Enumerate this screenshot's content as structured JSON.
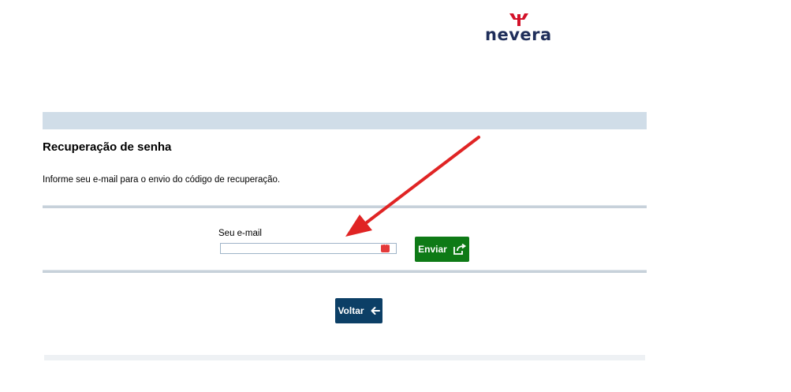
{
  "brand": {
    "logo_text": "nevera",
    "logo_color": "#1f2e5a",
    "mark_color": "#d3122a"
  },
  "page": {
    "title": "Recuperação de senha",
    "instruction": "Informe seu e-mail para o envio do código de recuperação."
  },
  "form": {
    "email_label": "Seu e-mail",
    "email_value": "",
    "input_icon": "password-manager-icon",
    "send_label": "Enviar",
    "send_icon": "external-link-icon",
    "back_label": "Voltar",
    "back_icon": "arrow-left-icon"
  },
  "colors": {
    "header_bar": "#d0dde8",
    "send_button": "#0e7a16",
    "back_button": "#0c3f66",
    "annotation_arrow": "#e02424"
  }
}
